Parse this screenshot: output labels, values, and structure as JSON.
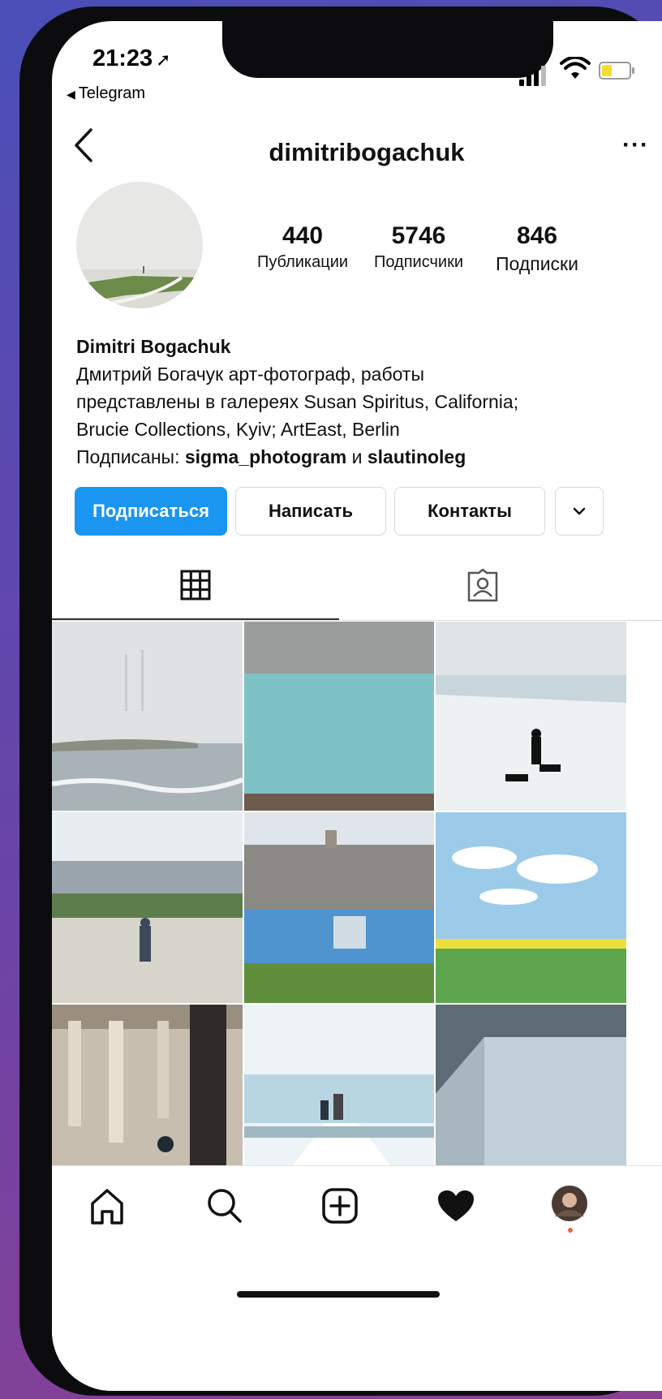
{
  "status_bar": {
    "time": "21:23",
    "time_arrow": "➚",
    "back_app": "Telegram",
    "battery_color": "#f2de2b"
  },
  "header": {
    "username": "dimitribogachuk",
    "more_label": "···"
  },
  "stats": [
    {
      "value": "440",
      "label": "Публикации"
    },
    {
      "value": "5746",
      "label": "Подписчики"
    },
    {
      "value": "846",
      "label": "Подписки"
    }
  ],
  "bio": {
    "name": "Dimitri Bogachuk",
    "line1": "Дмитрий Богачук арт-фотограф, работы",
    "line2": "представлены в галереях Susan Spiritus, California;",
    "line3": "Brucie Collections, Kyiv; ArtEast, Berlin",
    "followed_prefix": "Подписаны: ",
    "followed_user1": "sigma_photogram",
    "followed_and": " и ",
    "followed_user2": "slautinoleg"
  },
  "actions": {
    "follow": "Подписаться",
    "message": "Написать",
    "contacts": "Контакты"
  },
  "tabs": [
    {
      "icon": "grid-icon",
      "active": true
    },
    {
      "icon": "tagged-user-icon",
      "active": false
    }
  ],
  "posts": [
    {
      "icon": "photo-foggy-seashore"
    },
    {
      "icon": "photo-turquoise-water"
    },
    {
      "icon": "photo-person-dogs-on-snow"
    },
    {
      "icon": "photo-park-with-people"
    },
    {
      "icon": "photo-blue-house"
    },
    {
      "icon": "photo-rapeseed-field-sky"
    },
    {
      "icon": "photo-mosque-columns"
    },
    {
      "icon": "photo-pier-people"
    },
    {
      "icon": "photo-grey-wall-stairs"
    }
  ],
  "bottom_nav": [
    {
      "icon": "home-icon"
    },
    {
      "icon": "search-icon"
    },
    {
      "icon": "add-post-icon"
    },
    {
      "icon": "heart-icon"
    },
    {
      "icon": "profile-avatar-icon"
    }
  ],
  "colors": {
    "primary_button": "#1a95f0",
    "notification_dot": "#e9654a"
  }
}
